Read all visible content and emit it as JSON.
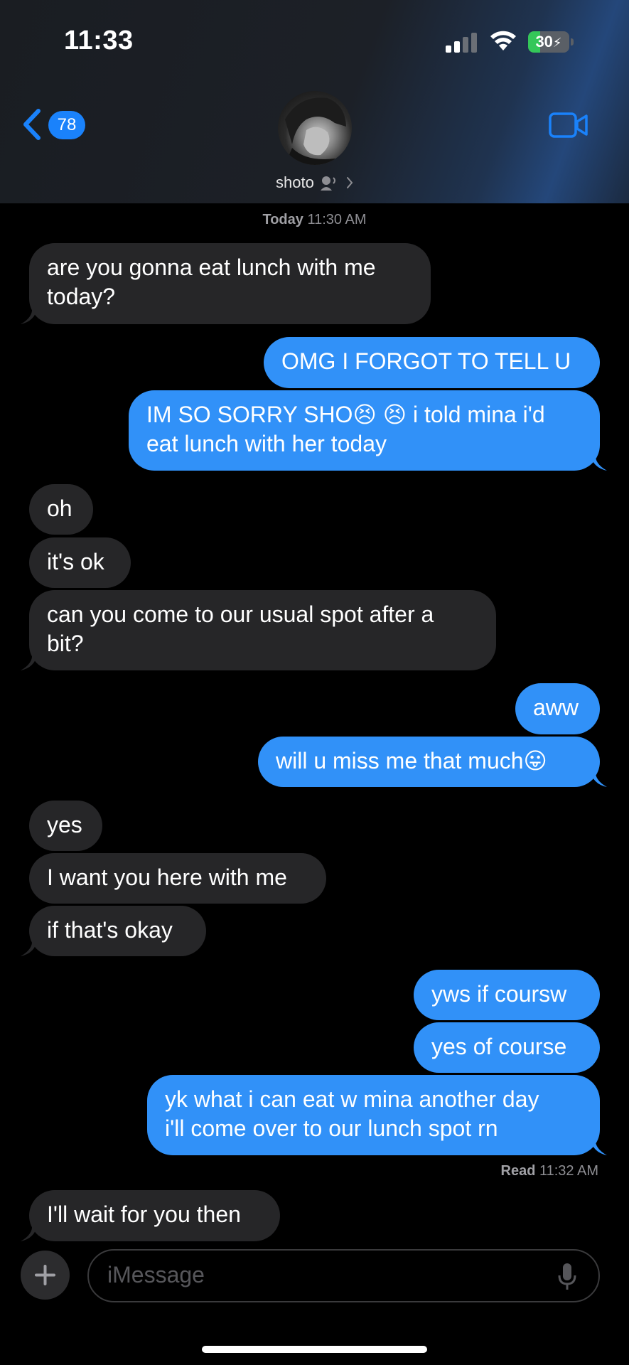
{
  "status_bar": {
    "time": "11:33",
    "battery": "30",
    "battery_level": 0.3,
    "signal_icon": "cellular-signal-icon",
    "wifi_icon": "wifi-icon",
    "battery_icon": "battery-charging-icon"
  },
  "header": {
    "back_badge": "78",
    "contact_name": "shoto",
    "back_icon": "chevron-left-icon",
    "facetime_icon": "video-camera-icon",
    "speaker_icon": "person-speaking-icon",
    "disclosure_icon": "chevron-right-icon"
  },
  "conversation": {
    "date_label": "Today",
    "date_time": "11:30 AM",
    "messages": [
      {
        "dir": "in",
        "text": "are you gonna eat lunch with me\ntoday?"
      },
      {
        "dir": "out",
        "text": "OMG I FORGOT TO TELL U"
      },
      {
        "dir": "out",
        "text": "IM SO SORRY SHO😣 😣 i told mina i'd\neat lunch with her today"
      },
      {
        "dir": "in",
        "text": "oh"
      },
      {
        "dir": "in",
        "text": "it's ok"
      },
      {
        "dir": "in",
        "text": "can you come to our usual spot after a\nbit?"
      },
      {
        "dir": "out",
        "text": "aww"
      },
      {
        "dir": "out",
        "text": "will u miss me that much😛"
      },
      {
        "dir": "in",
        "text": "yes"
      },
      {
        "dir": "in",
        "text": "I want you here with me"
      },
      {
        "dir": "in",
        "text": "if that's okay"
      },
      {
        "dir": "out",
        "text": "yws if coursw"
      },
      {
        "dir": "out",
        "text": "yes of course"
      },
      {
        "dir": "out",
        "text": "yk what i can eat w mina another day\ni'll come over to our lunch spot rn"
      },
      {
        "dir": "in",
        "text": "I'll wait for you then"
      }
    ],
    "read_label": "Read",
    "read_time": "11:32 AM"
  },
  "composer": {
    "placeholder": "iMessage",
    "plus_icon": "plus-icon",
    "mic_icon": "microphone-icon"
  },
  "colors": {
    "outgoing_bubble": "#3191f8",
    "incoming_bubble": "#262628",
    "accent": "#1a82fb"
  }
}
